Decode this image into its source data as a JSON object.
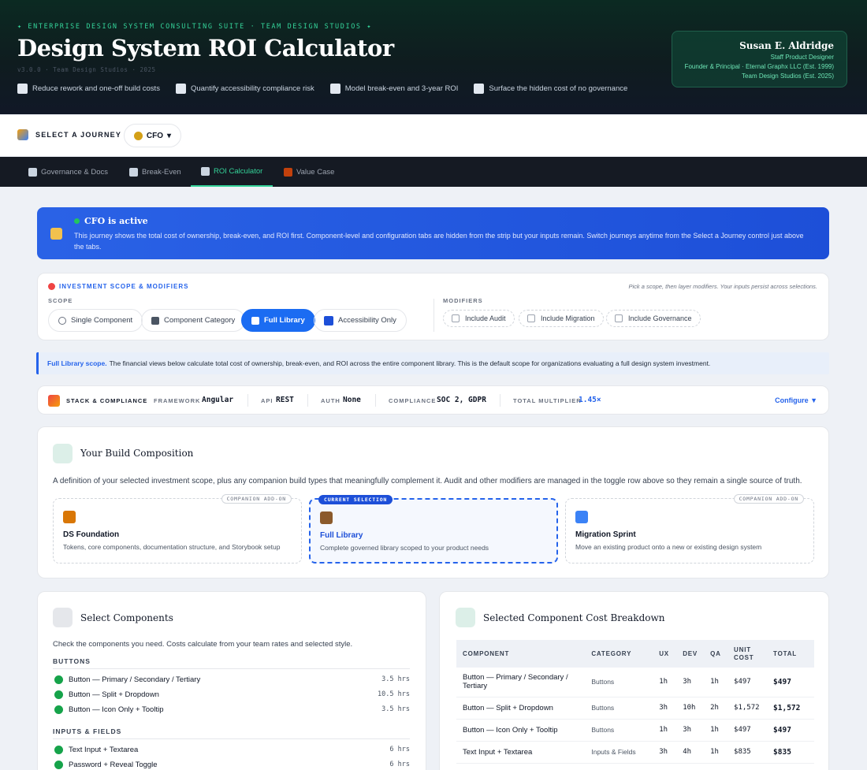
{
  "header": {
    "eyebrow": "✦ ENTERPRISE DESIGN SYSTEM CONSULTING SUITE · TEAM DESIGN STUDIOS ✦",
    "title": "Design System ROI Calculator",
    "version": "v3.0.0 · Team Design Studios · 2025",
    "value_props": [
      {
        "icon": "chart-down-icon",
        "label": "Reduce rework and one-off build costs"
      },
      {
        "icon": "scales-icon",
        "label": "Quantify accessibility compliance risk"
      },
      {
        "icon": "chart-up-icon",
        "label": "Model break-even and 3-year ROI"
      },
      {
        "icon": "bank-icon",
        "label": "Surface the hidden cost of no governance"
      }
    ],
    "profile": {
      "name": "Susan E. Aldridge",
      "role": "Staff Product Designer",
      "line1": "Founder & Principal · Eternal Graphx LLC (Est. 1999)",
      "line2": "Team Design Studios (Est. 2025)"
    }
  },
  "journey": {
    "label": "SELECT A JOURNEY",
    "selected": "CFO"
  },
  "tabs": [
    {
      "icon": "clipboard-icon",
      "label": "Governance & Docs",
      "active": false
    },
    {
      "icon": "chart-down-icon",
      "label": "Break-Even",
      "active": false
    },
    {
      "icon": "chart-up-icon",
      "label": "ROI Calculator",
      "active": true
    },
    {
      "icon": "briefcase-icon",
      "label": "Value Case",
      "active": false
    }
  ],
  "banner": {
    "title": "CFO is active",
    "text": "This journey shows the total cost of ownership, break-even, and ROI first. Component-level and configuration tabs are hidden from the strip but your inputs remain. Switch journeys anytime from the Select a Journey control just above the tabs."
  },
  "scope": {
    "heading": "INVESTMENT SCOPE & MODIFIERS",
    "hint": "Pick a scope, then layer modifiers. Your inputs persist across selections.",
    "scope_label": "SCOPE",
    "modifiers_label": "MODIFIERS",
    "options": [
      "Single Component",
      "Component Category",
      "Full Library",
      "Accessibility Only"
    ],
    "selected": "Full Library",
    "modifiers": [
      "Include Audit",
      "Include Migration",
      "Include Governance"
    ]
  },
  "info": {
    "lead": "Full Library scope.",
    "text": "The financial views below calculate total cost of ownership, break-even, and ROI across the entire component library. This is the default scope for organizations evaluating a full design system investment."
  },
  "stack": {
    "title": "STACK & COMPLIANCE",
    "framework_label": "FRAMEWORK",
    "framework": "Angular",
    "api_label": "API",
    "api": "REST",
    "auth_label": "AUTH",
    "auth": "None",
    "compliance_label": "COMPLIANCE",
    "compliance": "SOC 2, GDPR",
    "multiplier_label": "TOTAL MULTIPLIER",
    "multiplier": "1.45×",
    "configure": "Configure ▼"
  },
  "build": {
    "title": "Your Build Composition",
    "description": "A definition of your selected investment scope, plus any companion build types that meaningfully complement it. Audit and other modifiers are managed in the toggle row above so they remain a single source of truth.",
    "options": [
      {
        "badge": "COMPANION ADD-ON",
        "name": "DS Foundation",
        "desc": "Tokens, core components, documentation structure, and Storybook setup"
      },
      {
        "badge": "CURRENT SELECTION",
        "name": "Full Library",
        "desc": "Complete governed library scoped to your product needs"
      },
      {
        "badge": "COMPANION ADD-ON",
        "name": "Migration Sprint",
        "desc": "Move an existing product onto a new or existing design system"
      }
    ]
  },
  "components": {
    "title": "Select Components",
    "lead": "Check the components you need. Costs calculate from your team rates and selected style.",
    "groups": [
      {
        "name": "BUTTONS",
        "items": [
          {
            "label": "Button — Primary / Secondary / Tertiary",
            "hours": "3.5 hrs"
          },
          {
            "label": "Button — Split + Dropdown",
            "hours": "10.5 hrs"
          },
          {
            "label": "Button — Icon Only + Tooltip",
            "hours": "3.5 hrs"
          }
        ]
      },
      {
        "name": "INPUTS & FIELDS",
        "items": [
          {
            "label": "Text Input + Textarea",
            "hours": "6 hrs"
          },
          {
            "label": "Password + Reveal Toggle",
            "hours": "6 hrs"
          }
        ]
      }
    ]
  },
  "cost": {
    "title": "Selected Component Cost Breakdown",
    "headers": [
      "COMPONENT",
      "CATEGORY",
      "UX",
      "DEV",
      "QA",
      "UNIT COST",
      "TOTAL"
    ],
    "rows": [
      [
        "Button — Primary / Secondary / Tertiary",
        "Buttons",
        "1h",
        "3h",
        "1h",
        "$497",
        "$497"
      ],
      [
        "Button — Split + Dropdown",
        "Buttons",
        "3h",
        "10h",
        "2h",
        "$1,572",
        "$1,572"
      ],
      [
        "Button — Icon Only + Tooltip",
        "Buttons",
        "1h",
        "3h",
        "1h",
        "$497",
        "$497"
      ],
      [
        "Text Input + Textarea",
        "Inputs & Fields",
        "3h",
        "4h",
        "1h",
        "$835",
        "$835"
      ]
    ]
  }
}
